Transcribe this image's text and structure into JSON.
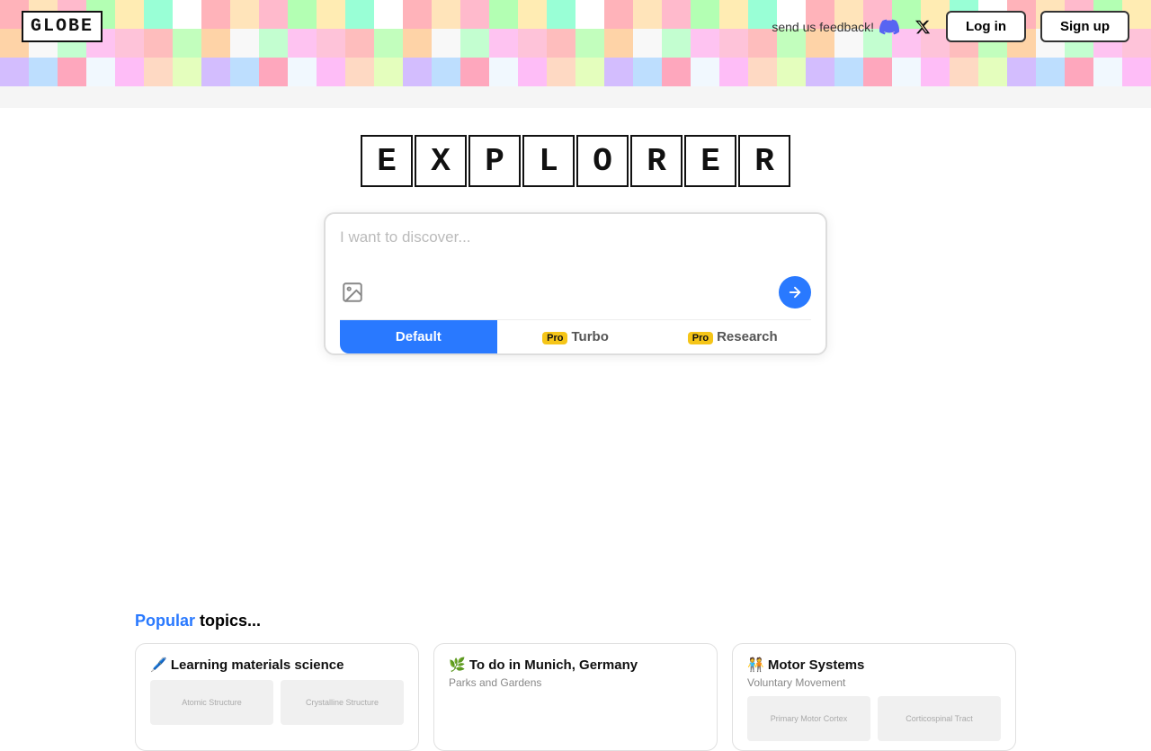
{
  "app": {
    "logo_text": "GLOBE"
  },
  "navbar": {
    "feedback_label": "send us feedback!",
    "login_label": "Log in",
    "signup_label": "Sign up"
  },
  "hero": {
    "title_letters": [
      "E",
      "X",
      "P",
      "L",
      "O",
      "R",
      "E",
      "R"
    ],
    "title_text": "EXPLORER"
  },
  "search": {
    "placeholder": "I want to discover...",
    "default_tab": "Default",
    "turbo_tab": "Turbo",
    "research_tab": "Research",
    "pro_badge": "Pro"
  },
  "popular": {
    "label_popular": "Popular",
    "label_rest": " topics...",
    "topics": [
      {
        "emoji": "🖊️",
        "title": "Learning materials science",
        "subtitle": "",
        "preview1": "Atomic Structure",
        "preview2": "Crystalline Structure"
      },
      {
        "emoji": "🌿",
        "title": "To do in Munich, Germany",
        "subtitle": "Parks and Gardens",
        "preview1": "",
        "preview2": ""
      },
      {
        "emoji": "🧑‍🤝‍🧑",
        "title": "Motor Systems",
        "subtitle": "Voluntary Movement",
        "preview1": "Primary Motor Cortex",
        "preview2": "Corticospinal Tract"
      }
    ]
  },
  "pixel_colors": [
    "#FFB3BA",
    "#FFDFBA",
    "#FFFFBA",
    "#BAFFC9",
    "#BAE1FF",
    "#E8BAFF",
    "#FFB3F7",
    "#B3FFD9",
    "#FFE4BA",
    "#D4FFBA",
    "#BAF0FF",
    "#FFBAF0",
    "#F0FFBA",
    "#BAFFED",
    "#FFD4BA",
    "#CBBAFF",
    "#FFBACC",
    "#BAF7FF",
    "#FAFFBA",
    "#FFBAD4",
    "#B3EEFF",
    "#FFDAB9",
    "#E0FFB3",
    "#FFB3E6",
    "#B3FFB3",
    "#FFD9B3",
    "#B3B3FF",
    "#FFB3B3",
    "#B3FFD4",
    "#FFCCB3",
    "#CCB3FF",
    "#B3CCFF",
    "#FFECB3",
    "#B3FFB8",
    "#FFB3EC",
    "#B8FFB3",
    "#FFB8D9",
    "#D9B3FF",
    "#B3D9FF",
    "#FFEB99",
    "#99FFD6",
    "#FF99CC",
    "#99CCFF",
    "#FFCC99",
    "#CC99FF",
    "#99FFCC",
    "#FF99B3",
    "#CCF299"
  ]
}
